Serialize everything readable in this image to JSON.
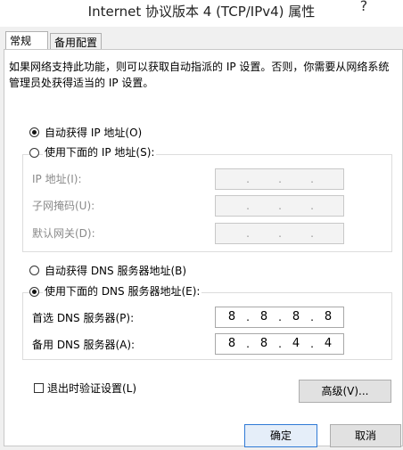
{
  "window": {
    "title": "Internet 协议版本 4 (TCP/IPv4) 属性",
    "close_glyph": "?"
  },
  "tabs": [
    {
      "label": "常规",
      "active": true
    },
    {
      "label": "备用配置",
      "active": false
    }
  ],
  "description": "如果网络支持此功能，则可以获取自动指派的 IP 设置。否则，你需要从网络系统管理员处获得适当的 IP 设置。",
  "ip_section": {
    "auto_option": "自动获得 IP 地址(O)",
    "manual_option": "使用下面的 IP 地址(S):",
    "selected": "auto",
    "fields": [
      {
        "label": "IP 地址(I):",
        "segments": [
          "",
          "",
          "",
          ""
        ]
      },
      {
        "label": "子网掩码(U):",
        "segments": [
          "",
          "",
          "",
          ""
        ]
      },
      {
        "label": "默认网关(D):",
        "segments": [
          "",
          "",
          "",
          ""
        ]
      }
    ]
  },
  "dns_section": {
    "auto_option": "自动获得 DNS 服务器地址(B)",
    "manual_option": "使用下面的 DNS 服务器地址(E):",
    "selected": "manual",
    "preferred": {
      "label": "首选 DNS 服务器(P):",
      "segments": [
        "8",
        "8",
        "8",
        "8"
      ]
    },
    "alternate": {
      "label": "备用 DNS 服务器(A):",
      "segments": [
        "8",
        "8",
        "4",
        "4"
      ]
    }
  },
  "validate_checkbox": {
    "label": "退出时验证设置(L)",
    "checked": false
  },
  "buttons": {
    "advanced": "高级(V)...",
    "ok": "确定",
    "cancel": "取消"
  },
  "colors": {
    "default_button_border": "#2f7ad6",
    "disabled_text": "#8a8a8a"
  }
}
